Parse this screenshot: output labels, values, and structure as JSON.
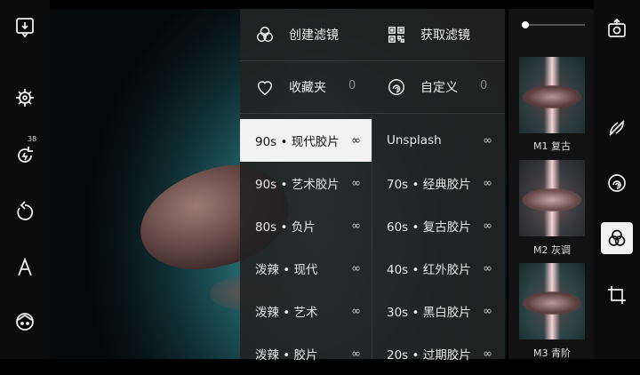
{
  "left_toolbar": {
    "rotate_badge": "38",
    "icons": [
      "import-photo-icon",
      "wheel-icon",
      "rotate-icon",
      "undo-icon",
      "text-icon",
      "face-icon"
    ]
  },
  "header": {
    "create_filter": "创建滤镜",
    "get_filter": "获取滤镜",
    "favorites": "收藏夹",
    "favorites_count": "0",
    "custom": "自定义",
    "custom_count": "0"
  },
  "filters": {
    "left": [
      {
        "label": "90s • 现代胶片",
        "count": "∞",
        "selected": true
      },
      {
        "label": "90s • 艺术胶片",
        "count": "∞"
      },
      {
        "label": "80s • 负片",
        "count": "∞"
      },
      {
        "label": "泼辣 • 现代",
        "count": "∞"
      },
      {
        "label": "泼辣 • 艺术",
        "count": "∞"
      },
      {
        "label": "泼辣 • 胶片",
        "count": "∞"
      }
    ],
    "right": [
      {
        "label": "Unsplash",
        "count": "∞"
      },
      {
        "label": "70s • 经典胶片",
        "count": "∞"
      },
      {
        "label": "60s • 复古胶片",
        "count": "∞"
      },
      {
        "label": "40s • 红外胶片",
        "count": "∞"
      },
      {
        "label": "30s • 黑白胶片",
        "count": "∞"
      },
      {
        "label": "20s • 过期胶片",
        "count": "∞"
      }
    ]
  },
  "presets": [
    {
      "label": "M1 复古"
    },
    {
      "label": "M2 灰调"
    },
    {
      "label": "M3 青阶"
    }
  ],
  "colors": {
    "selected_bg": "#f2f2f2",
    "panel_bg": "#222222",
    "accent_beam": "#ffdcdc"
  }
}
